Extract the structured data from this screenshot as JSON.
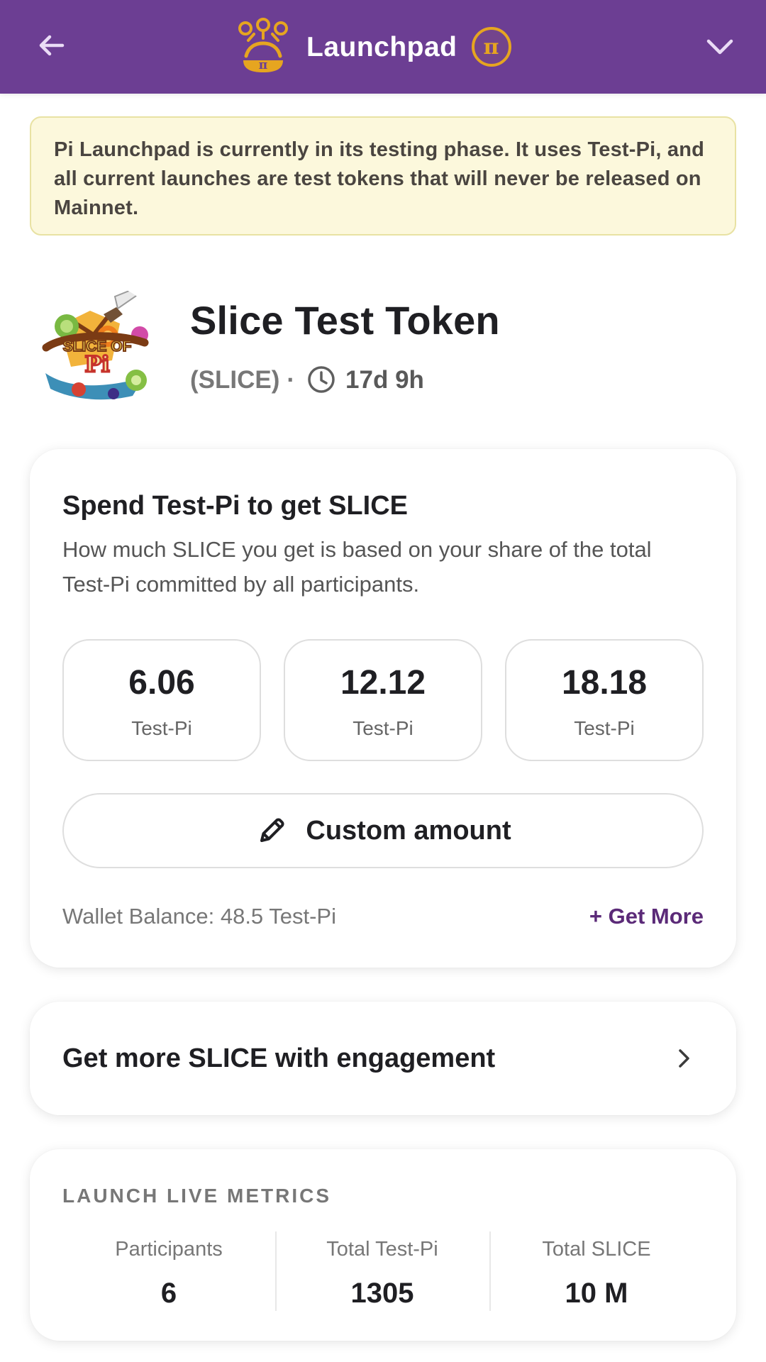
{
  "header": {
    "title": "Launchpad",
    "back_icon": "arrow-left-icon",
    "launchpad_icon": "launchpad-icon",
    "currency_badge": "π",
    "dropdown_icon": "chevron-down-icon",
    "background_color": "#6c3e93",
    "accent_color": "#e6a520"
  },
  "notice": {
    "text": "Pi Launchpad is currently in its testing phase. It uses Test-Pi, and all current launches are test tokens that will never be released on Mainnet.",
    "background_color": "#fcf8dc",
    "border_color": "#e8e2a3"
  },
  "token": {
    "name": "Slice Test Token",
    "symbol": "(SLICE)",
    "separator": "·",
    "time_left": "17d 9h",
    "logo_text_top": "SLICE OF",
    "logo_text_bottom": "Pi",
    "clock_icon": "clock-icon"
  },
  "spend": {
    "title": "Spend Test-Pi to get SLICE",
    "description": "How much SLICE you get is based on your share of the total Test-Pi committed by all participants.",
    "options": [
      {
        "value": "6.06",
        "unit": "Test-Pi"
      },
      {
        "value": "12.12",
        "unit": "Test-Pi"
      },
      {
        "value": "18.18",
        "unit": "Test-Pi"
      }
    ],
    "custom_amount_label": "Custom amount",
    "custom_amount_icon": "pencil-icon",
    "wallet_balance": "Wallet Balance: 48.5 Test-Pi",
    "get_more": "+ Get More",
    "get_more_color": "#5b2a78"
  },
  "engagement": {
    "label": "Get more SLICE with engagement",
    "chevron_icon": "chevron-right-icon"
  },
  "metrics": {
    "title": "LAUNCH LIVE METRICS",
    "items": [
      {
        "label": "Participants",
        "value": "6"
      },
      {
        "label": "Total Test-Pi",
        "value": "1305"
      },
      {
        "label": "Total SLICE",
        "value": "10 M"
      }
    ]
  }
}
